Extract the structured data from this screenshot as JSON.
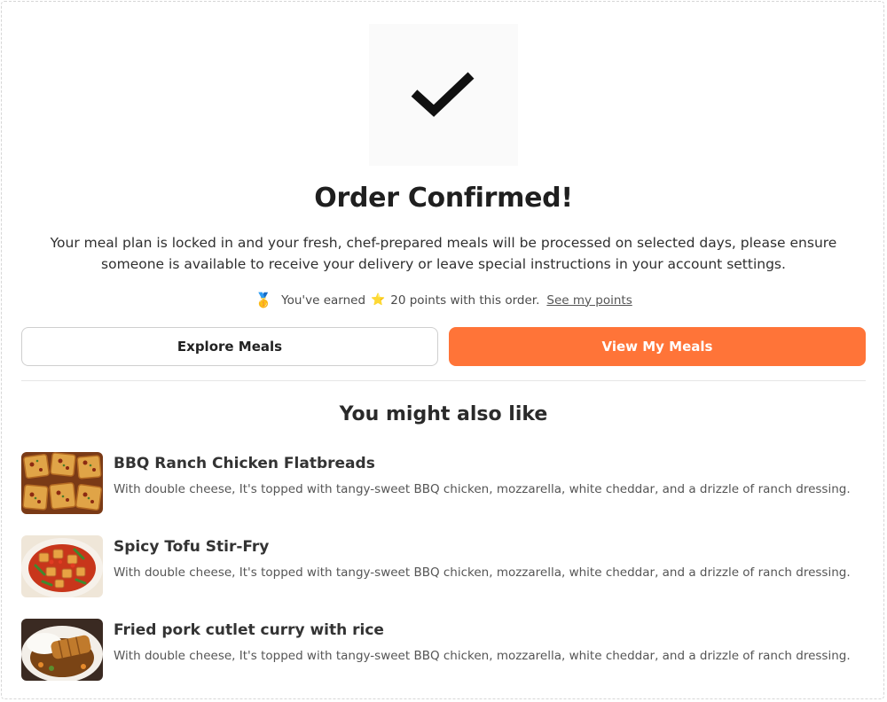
{
  "confirmation": {
    "title": "Order Confirmed!",
    "message": "Your meal plan is locked in and your fresh, chef-prepared meals will be processed on selected days, please ensure someone is available to receive your delivery or leave special instructions in your account settings.",
    "icon": "checkmark-icon"
  },
  "points": {
    "medal_icon": "🥇",
    "text_before": "You've earned",
    "star_icon": "⭐",
    "text_after": "20 points with this order.",
    "link_label": "See my points"
  },
  "actions": {
    "explore_label": "Explore Meals",
    "view_label": "View My Meals",
    "accent_color": "#ff7438"
  },
  "recommendations": {
    "title": "You might also like",
    "items": [
      {
        "name": "BBQ Ranch Chicken Flatbreads",
        "description": "With double cheese, It's topped with tangy-sweet BBQ chicken, mozzarella, white cheddar, and a drizzle of ranch dressing.",
        "image": "flatbread-photo"
      },
      {
        "name": "Spicy Tofu Stir-Fry",
        "description": "With double cheese, It's topped with tangy-sweet BBQ chicken, mozzarella, white cheddar, and a drizzle of ranch dressing.",
        "image": "tofu-stirfry-photo"
      },
      {
        "name": "Fried pork cutlet curry with rice",
        "description": "With double cheese, It's topped with tangy-sweet BBQ chicken, mozzarella, white cheddar, and a drizzle of ranch dressing.",
        "image": "pork-cutlet-curry-photo"
      }
    ]
  }
}
